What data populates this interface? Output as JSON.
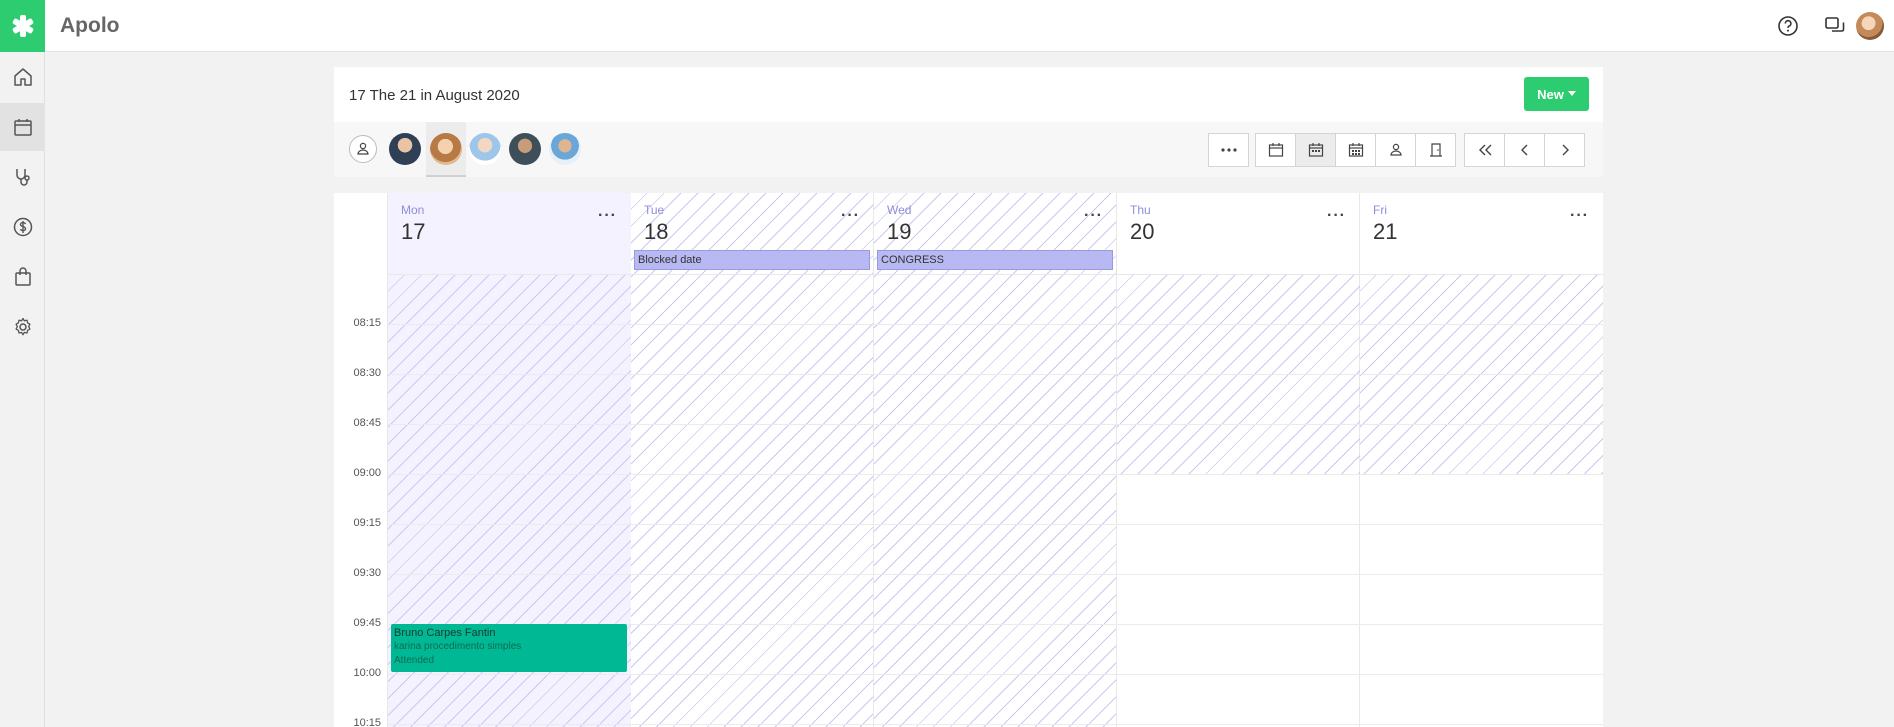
{
  "app": {
    "title": "Apolo",
    "brand_color": "#2ecc71",
    "icons": [
      "asterisk-logo-icon",
      "help-icon",
      "chat-icon"
    ]
  },
  "sidebar": {
    "items": [
      {
        "icon": "home-icon",
        "active": false
      },
      {
        "icon": "calendar-icon",
        "active": true
      },
      {
        "icon": "stethoscope-icon",
        "active": false
      },
      {
        "icon": "dollar-icon",
        "active": false
      },
      {
        "icon": "shopping-bag-icon",
        "active": false
      },
      {
        "icon": "gear-icon",
        "active": false
      }
    ]
  },
  "header": {
    "title": "17 The 21 in August 2020",
    "new_label": "New"
  },
  "toolbar": {
    "views": [
      "more-icon",
      "calendar-day-icon",
      "calendar-week-icon",
      "calendar-month-icon",
      "professional-icon",
      "room-icon"
    ],
    "active_view": "calendar-week-icon",
    "nav": [
      "double-chevron-left-icon",
      "chevron-left-icon",
      "chevron-right-icon"
    ]
  },
  "calendar": {
    "times": [
      "08:15",
      "08:30",
      "08:45",
      "09:00",
      "09:15",
      "09:30",
      "09:45",
      "10:00",
      "10:15"
    ],
    "days": [
      {
        "name": "Mon",
        "number": "17",
        "blocked": ""
      },
      {
        "name": "Tue",
        "number": "18",
        "blocked": "Blocked date"
      },
      {
        "name": "Wed",
        "number": "19",
        "blocked": "CONGRESS"
      },
      {
        "name": "Thu",
        "number": "20",
        "blocked": ""
      },
      {
        "name": "Fri",
        "number": "21",
        "blocked": ""
      }
    ],
    "more_label": "···",
    "appointment": {
      "patient": "Bruno Carpes Fantin",
      "procedure": "karina procedimento simples",
      "status": "Attended",
      "color": "#00b894"
    }
  }
}
